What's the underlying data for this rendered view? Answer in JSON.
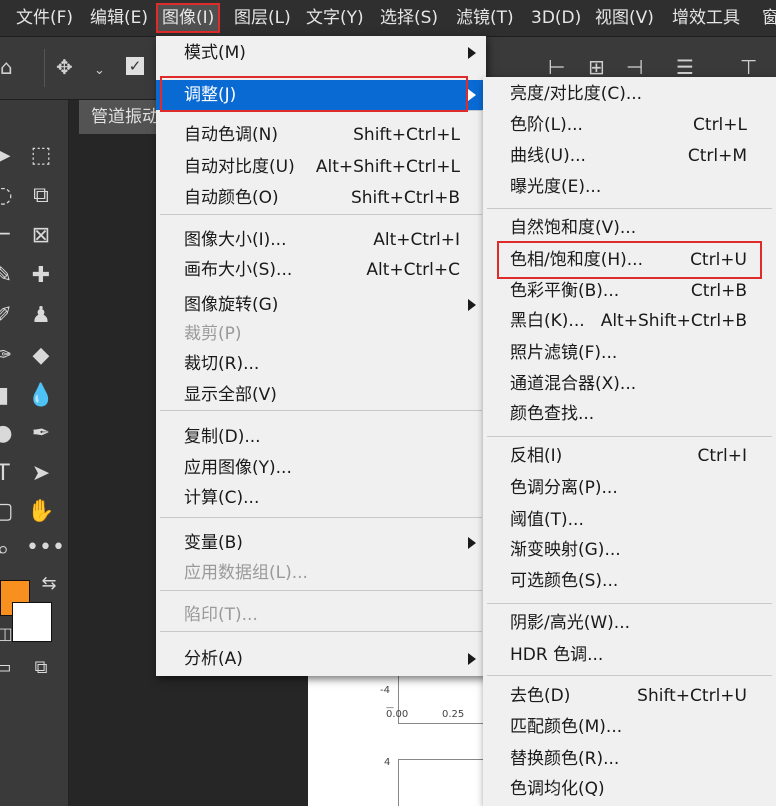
{
  "menubar": {
    "items": [
      "文件(F)",
      "编辑(E)",
      "图像(I)",
      "图层(L)",
      "文字(Y)",
      "选择(S)",
      "滤镜(T)",
      "3D(D)",
      "视图(V)",
      "增效工具",
      "窗"
    ]
  },
  "document": {
    "tab_title": "管道振动",
    "axis": {
      "tick_y1": "-4",
      "tick_y2": "4",
      "tick_x1": "0.00",
      "tick_x2": "0.25"
    }
  },
  "image_menu": {
    "items": [
      {
        "label": "模式(M)",
        "shortcut": "",
        "submenu": true,
        "disabled": false
      },
      {
        "label": "调整(J)",
        "shortcut": "",
        "submenu": true,
        "disabled": false,
        "highlighted": true
      },
      {
        "label": "自动色调(N)",
        "shortcut": "Shift+Ctrl+L"
      },
      {
        "label": "自动对比度(U)",
        "shortcut": "Alt+Shift+Ctrl+L"
      },
      {
        "label": "自动颜色(O)",
        "shortcut": "Shift+Ctrl+B"
      },
      {
        "label": "图像大小(I)...",
        "shortcut": "Alt+Ctrl+I"
      },
      {
        "label": "画布大小(S)...",
        "shortcut": "Alt+Ctrl+C"
      },
      {
        "label": "图像旋转(G)",
        "shortcut": "",
        "submenu": true
      },
      {
        "label": "裁剪(P)",
        "shortcut": "",
        "disabled": true
      },
      {
        "label": "裁切(R)...",
        "shortcut": ""
      },
      {
        "label": "显示全部(V)",
        "shortcut": ""
      },
      {
        "label": "复制(D)...",
        "shortcut": ""
      },
      {
        "label": "应用图像(Y)...",
        "shortcut": ""
      },
      {
        "label": "计算(C)...",
        "shortcut": ""
      },
      {
        "label": "变量(B)",
        "shortcut": "",
        "submenu": true
      },
      {
        "label": "应用数据组(L)...",
        "shortcut": "",
        "disabled": true
      },
      {
        "label": "陷印(T)...",
        "shortcut": "",
        "disabled": true
      },
      {
        "label": "分析(A)",
        "shortcut": "",
        "submenu": true
      }
    ]
  },
  "adjust_menu": {
    "items": [
      {
        "label": "亮度/对比度(C)...",
        "shortcut": ""
      },
      {
        "label": "色阶(L)...",
        "shortcut": "Ctrl+L"
      },
      {
        "label": "曲线(U)...",
        "shortcut": "Ctrl+M"
      },
      {
        "label": "曝光度(E)...",
        "shortcut": ""
      },
      {
        "label": "自然饱和度(V)...",
        "shortcut": ""
      },
      {
        "label": "色相/饱和度(H)...",
        "shortcut": "Ctrl+U",
        "boxed": true
      },
      {
        "label": "色彩平衡(B)...",
        "shortcut": "Ctrl+B"
      },
      {
        "label": "黑白(K)...",
        "shortcut": "Alt+Shift+Ctrl+B"
      },
      {
        "label": "照片滤镜(F)...",
        "shortcut": ""
      },
      {
        "label": "通道混合器(X)...",
        "shortcut": ""
      },
      {
        "label": "颜色查找...",
        "shortcut": ""
      },
      {
        "label": "反相(I)",
        "shortcut": "Ctrl+I"
      },
      {
        "label": "色调分离(P)...",
        "shortcut": ""
      },
      {
        "label": "阈值(T)...",
        "shortcut": ""
      },
      {
        "label": "渐变映射(G)...",
        "shortcut": ""
      },
      {
        "label": "可选颜色(S)...",
        "shortcut": ""
      },
      {
        "label": "阴影/高光(W)...",
        "shortcut": ""
      },
      {
        "label": "HDR 色调...",
        "shortcut": ""
      },
      {
        "label": "去色(D)",
        "shortcut": "Shift+Ctrl+U"
      },
      {
        "label": "匹配颜色(M)...",
        "shortcut": ""
      },
      {
        "label": "替换颜色(R)...",
        "shortcut": ""
      },
      {
        "label": "色调均化(Q)",
        "shortcut": ""
      }
    ]
  },
  "colors": {
    "highlight": "#0a6ad4",
    "annotation_red": "#e02b2b",
    "foreground_swatch": "#f7901e",
    "background_swatch": "#ffffff"
  }
}
